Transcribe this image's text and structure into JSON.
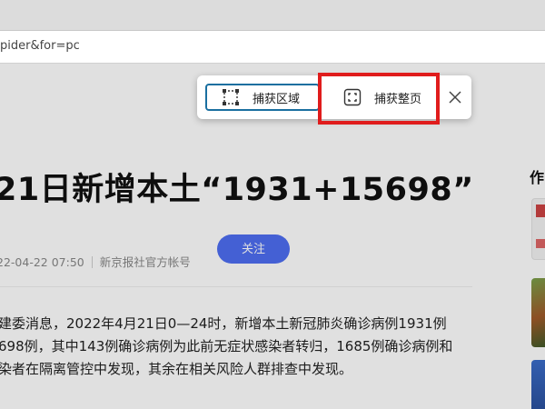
{
  "browser": {
    "url": "pider&for=pc"
  },
  "article": {
    "headline": "21日新增本土“1931+15698”",
    "date": "22-04-22 07:50",
    "source": "新京报社官方帐号",
    "follow_label": "关注",
    "paragraphs": [
      "建委消息，2022年4月21日0—24时，新增本土新冠肺炎确诊病例1931例",
      "698例，其中143例确诊病例为此前无症状感染者转归，1685例确诊病例和",
      "染者在隔离管控中发现，其余在相关风险人群排查中发现。"
    ]
  },
  "sidebar": {
    "title": "作"
  },
  "capture_toolbar": {
    "capture_area_label": "捕获区域",
    "capture_page_label": "捕获整页",
    "capture_area_icon": "selection-corners-icon",
    "capture_page_icon": "fullpage-capture-icon",
    "close_icon": "close-icon",
    "highlight_color": "#e01c1c",
    "accent_color": "#1a6fa0"
  }
}
